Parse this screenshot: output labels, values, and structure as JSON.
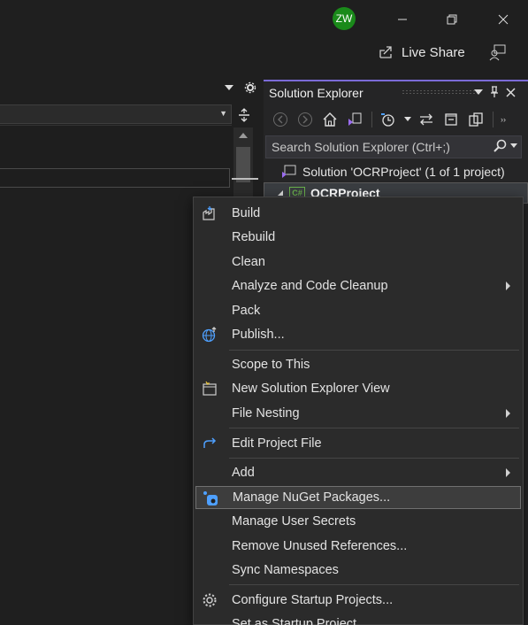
{
  "titlebar": {
    "avatar_initials": "ZW",
    "live_share": "Live Share"
  },
  "solution_explorer": {
    "title": "Solution Explorer",
    "search_placeholder": "Search Solution Explorer (Ctrl+;)",
    "solution_label": "Solution 'OCRProject' (1 of 1 project)",
    "project_label": "OCRProject",
    "project_badge": "C#"
  },
  "context_menu": {
    "items": [
      {
        "label": "Build",
        "icon": "build-icon"
      },
      {
        "label": "Rebuild"
      },
      {
        "label": "Clean"
      },
      {
        "label": "Analyze and Code Cleanup",
        "submenu": true
      },
      {
        "label": "Pack"
      },
      {
        "label": "Publish...",
        "icon": "globe-publish-icon"
      },
      {
        "label": "Scope to This"
      },
      {
        "label": "New Solution Explorer View",
        "icon": "new-view-icon"
      },
      {
        "label": "File Nesting",
        "submenu": true
      },
      {
        "label": "Edit Project File",
        "icon": "redo-arrow-icon"
      },
      {
        "label": "Add",
        "submenu": true
      },
      {
        "label": "Manage NuGet Packages...",
        "icon": "nuget-icon",
        "highlighted": true
      },
      {
        "label": "Manage User Secrets"
      },
      {
        "label": "Remove Unused References..."
      },
      {
        "label": "Sync Namespaces"
      },
      {
        "label": "Configure Startup Projects...",
        "icon": "gear-icon"
      },
      {
        "label": "Set as Startup Project"
      }
    ]
  },
  "colors": {
    "accent": "#7b6bd6",
    "avatar": "#1a8a1a",
    "background": "#1f1f1f",
    "menu_bg": "#2b2b2b"
  }
}
